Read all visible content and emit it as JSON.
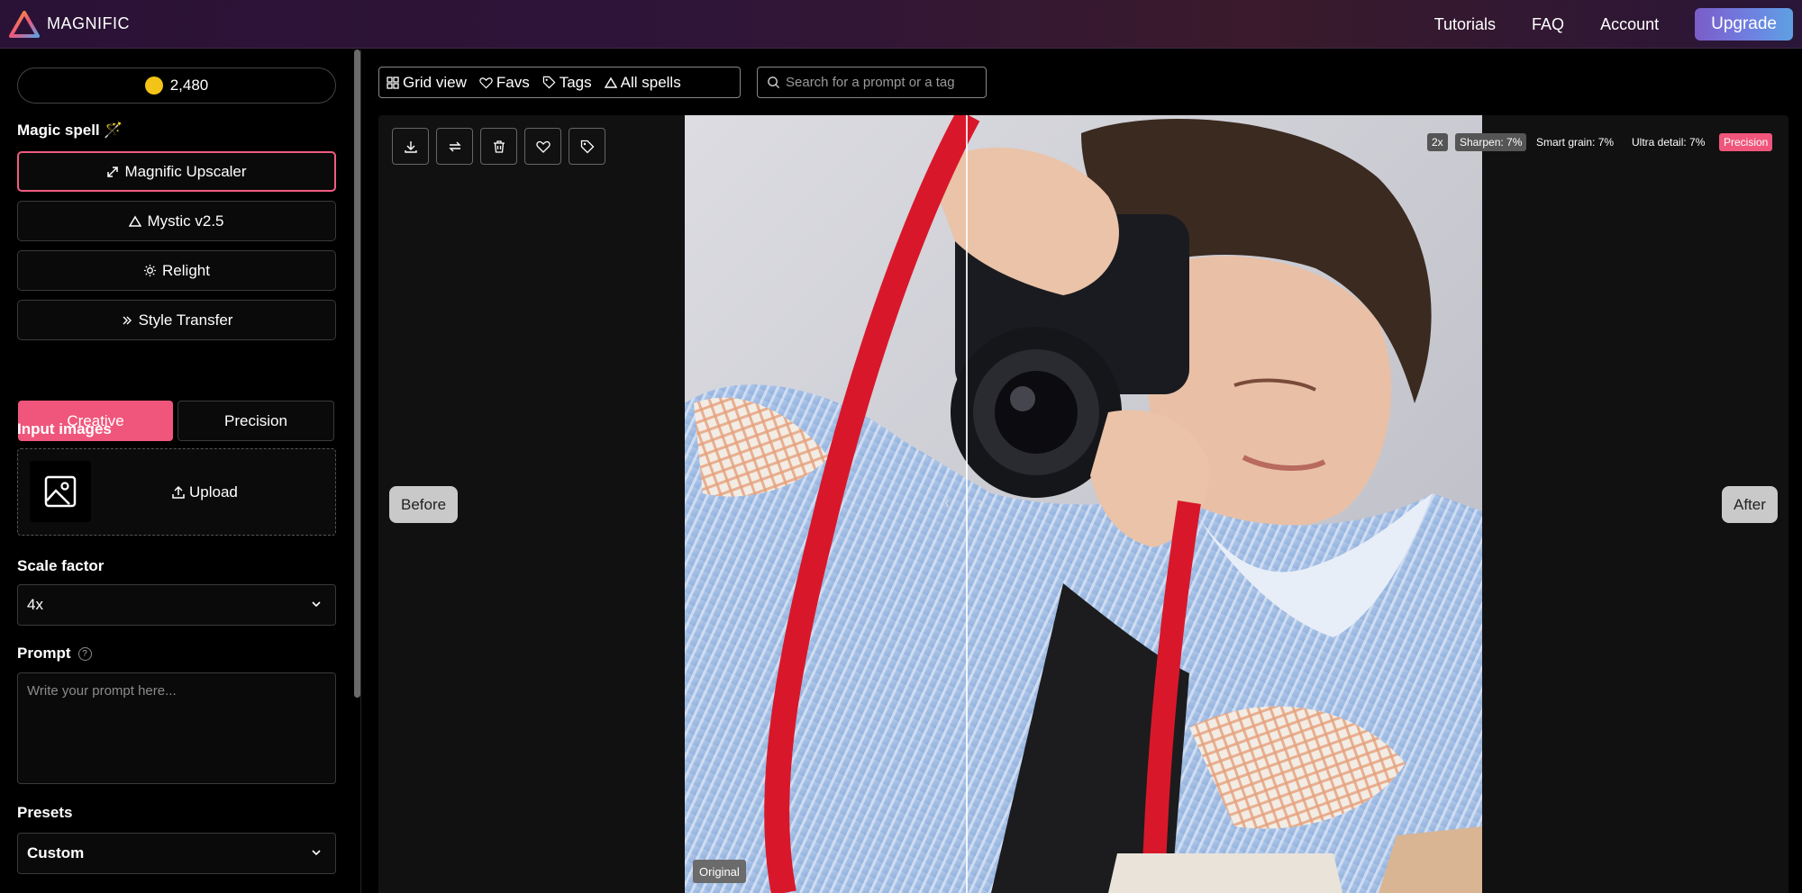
{
  "header": {
    "brand": "MAGNIFIC",
    "nav": [
      "Tutorials",
      "FAQ",
      "Account"
    ],
    "upgrade_label": "Upgrade"
  },
  "sidebar": {
    "credits": "2,480",
    "magic_spell_label": "Magic spell 🪄",
    "spells": [
      {
        "label": "Magnific Upscaler",
        "icon": "expand-icon",
        "active": true
      },
      {
        "label": "Mystic v2.5",
        "icon": "triangle-icon",
        "active": false
      },
      {
        "label": "Relight",
        "icon": "sun-icon",
        "active": false
      },
      {
        "label": "Style Transfer",
        "icon": "double-chevron-icon",
        "active": false
      }
    ],
    "modes": {
      "creative": "Creative",
      "precision": "Precision",
      "selected": "Creative"
    },
    "input_images_label": "Input images",
    "upload_label": "Upload",
    "scale_factor_label": "Scale factor",
    "scale_factor_value": "4x",
    "prompt_label": "Prompt",
    "prompt_placeholder": "Write your prompt here...",
    "presets_label": "Presets",
    "presets_value": "Custom"
  },
  "filters": {
    "items": [
      {
        "label": "Grid view",
        "icon": "grid-icon"
      },
      {
        "label": "Favs",
        "icon": "heart-icon"
      },
      {
        "label": "Tags",
        "icon": "tag-icon"
      },
      {
        "label": "All spells",
        "icon": "triangle-icon"
      }
    ],
    "search_placeholder": "Search for a prompt or a tag"
  },
  "viewer": {
    "toolbar": [
      "download-icon",
      "swap-icon",
      "trash-icon",
      "heart-icon",
      "tag-icon"
    ],
    "before_label": "Before",
    "after_label": "After",
    "original_badge": "Original",
    "settings_tags": {
      "scale": "2x",
      "sharpen": "Sharpen: 7%",
      "smart_grain": "Smart grain: 7%",
      "ultra_detail": "Ultra detail: 7%",
      "mode": "Precision"
    },
    "colors": {
      "accent_pink": "#f0567b",
      "strap_red": "#d8182a",
      "shirt_blue": "#a9c3e6"
    }
  }
}
